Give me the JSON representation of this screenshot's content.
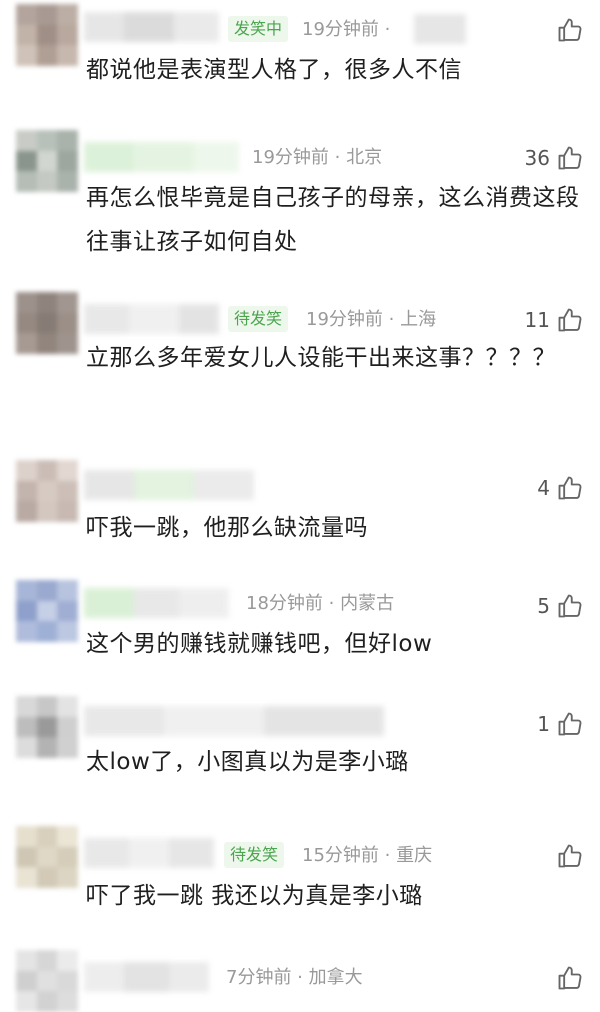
{
  "comments": [
    {
      "badge": "发笑中",
      "meta": "19分钟前 ·",
      "likes": "",
      "text": "都说他是表演型人格了，很多人不信"
    },
    {
      "badge": "",
      "meta": "19分钟前 · 北京",
      "likes": "36",
      "text": "再怎么恨毕竟是自己孩子的母亲，这么消费这段往事让孩子如何自处"
    },
    {
      "badge": "待发笑",
      "meta": "19分钟前 · 上海",
      "likes": "11",
      "text": "立那么多年爱女儿人设能干出来这事？？？？"
    },
    {
      "badge": "",
      "meta": "",
      "likes": "4",
      "text": "吓我一跳，他那么缺流量吗"
    },
    {
      "badge": "",
      "meta": "18分钟前 · 内蒙古",
      "likes": "5",
      "text": "这个男的赚钱就赚钱吧，但好low"
    },
    {
      "badge": "",
      "meta": "",
      "likes": "1",
      "text": "太low了，小图真以为是李小璐"
    },
    {
      "badge": "待发笑",
      "meta": "15分钟前 · 重庆",
      "likes": "",
      "text": "吓了我一跳 我还以为真是李小璐"
    },
    {
      "badge": "",
      "meta": "7分钟前 · 加拿大",
      "likes": "",
      "text": ""
    }
  ],
  "icons": {
    "like": "thumbs-up-icon"
  }
}
